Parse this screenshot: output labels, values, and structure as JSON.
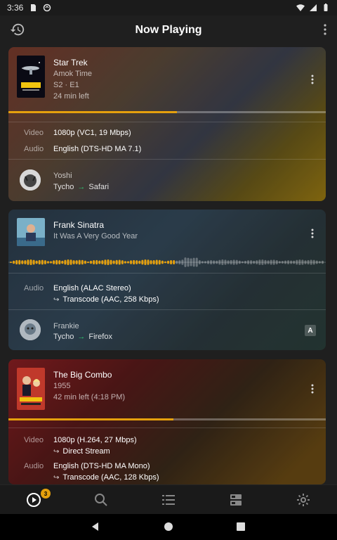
{
  "status_bar": {
    "time": "3:36"
  },
  "app_bar": {
    "title": "Now Playing"
  },
  "sessions": [
    {
      "title": "Star Trek",
      "subtitle": "Amok Time",
      "line3": "S2 · E1",
      "line4": "24 min left",
      "progress": 0.53,
      "video_label": "Video",
      "video_value": "1080p (VC1, 19 Mbps)",
      "audio_label": "Audio",
      "audio_value": "English (DTS-HD MA 7.1)",
      "user": "Yoshi",
      "player": "Tycho",
      "client": "Safari"
    },
    {
      "title": "Frank Sinatra",
      "subtitle": "It Was A Very Good Year",
      "progress": 0.52,
      "audio_label": "Audio",
      "audio_value": "English (ALAC Stereo)",
      "audio_transcode": "Transcode (AAC, 258 Kbps)",
      "user": "Frankie",
      "player": "Tycho",
      "client": "Firefox",
      "badge": "A"
    },
    {
      "title": "The Big Combo",
      "subtitle": "1955",
      "line3": "42 min left (4:18 PM)",
      "progress": 0.52,
      "video_label": "Video",
      "video_value": "1080p (H.264, 27 Mbps)",
      "video_stream": "Direct Stream",
      "audio_label": "Audio",
      "audio_value": "English (DTS-HD MA Mono)",
      "audio_transcode": "Transcode (AAC, 128 Kbps)"
    }
  ],
  "bottom_nav": {
    "badge_count": "3"
  },
  "colors": {
    "accent": "#e5a00d",
    "arrow": "#2ecc71"
  }
}
